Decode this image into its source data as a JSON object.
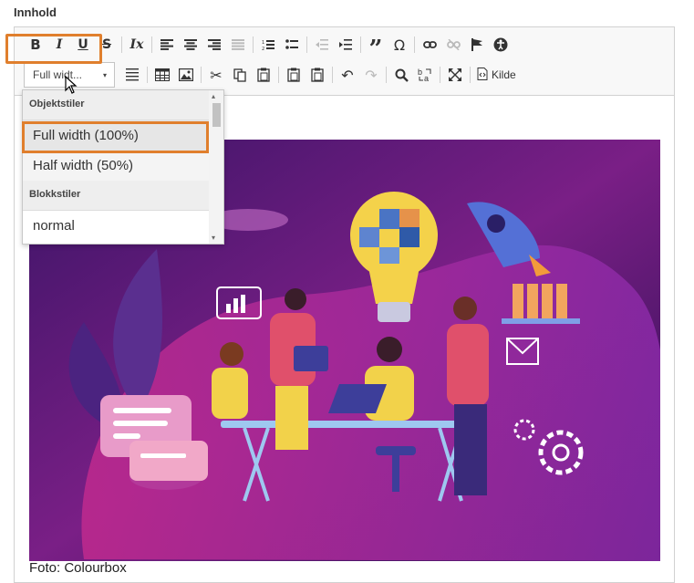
{
  "field": {
    "label": "Innhold"
  },
  "toolbar": {
    "row1": [
      {
        "name": "bold-button",
        "icon": "bold-icon",
        "glyph": "B",
        "style": "bold"
      },
      {
        "name": "italic-button",
        "icon": "italic-icon",
        "glyph": "I",
        "style": "italic"
      },
      {
        "name": "underline-button",
        "icon": "underline-icon",
        "glyph": "U",
        "style": "underline"
      },
      {
        "name": "strikethrough-button",
        "icon": "strikethrough-icon",
        "glyph": "S",
        "style": "strike"
      },
      {
        "sep": true
      },
      {
        "name": "remove-format-button",
        "icon": "remove-format-icon",
        "glyph": "Ix",
        "style": "italic"
      },
      {
        "sep": true
      },
      {
        "name": "align-left-button",
        "icon": "align-left-icon",
        "svg": "alignleft"
      },
      {
        "name": "align-center-button",
        "icon": "align-center-icon",
        "svg": "aligncenter"
      },
      {
        "name": "align-right-button",
        "icon": "align-right-icon",
        "svg": "alignright"
      },
      {
        "name": "justify-button",
        "icon": "justify-icon",
        "svg": "justify",
        "disabled": true
      },
      {
        "sep": true
      },
      {
        "name": "numbered-list-button",
        "icon": "numbered-list-icon",
        "svg": "numlist"
      },
      {
        "name": "bulleted-list-button",
        "icon": "bulleted-list-icon",
        "svg": "bullist"
      },
      {
        "sep": true
      },
      {
        "name": "outdent-button",
        "icon": "outdent-icon",
        "svg": "outdent",
        "disabled": true
      },
      {
        "name": "indent-button",
        "icon": "indent-icon",
        "svg": "indent"
      },
      {
        "sep": true
      },
      {
        "name": "blockquote-button",
        "icon": "quote-icon",
        "glyph": "”",
        "style": "quote"
      },
      {
        "name": "special-char-button",
        "icon": "omega-icon",
        "glyph": "Ω",
        "style": "plain"
      },
      {
        "sep": true
      },
      {
        "name": "link-button",
        "icon": "link-icon",
        "svg": "link"
      },
      {
        "name": "unlink-button",
        "icon": "unlink-icon",
        "svg": "unlink",
        "disabled": true
      },
      {
        "name": "anchor-button",
        "icon": "flag-icon",
        "svg": "flag"
      },
      {
        "name": "accessibility-button",
        "icon": "accessibility-icon",
        "svg": "access"
      }
    ],
    "style_combo": {
      "value": "Full widt...",
      "arrow": "▾"
    },
    "row2": [
      {
        "name": "horizontal-line-button",
        "icon": "horizontal-line-icon",
        "svg": "hr"
      },
      {
        "sep": true
      },
      {
        "name": "table-button",
        "icon": "table-icon",
        "svg": "table"
      },
      {
        "name": "image-button",
        "icon": "image-icon",
        "svg": "image"
      },
      {
        "sep": true
      },
      {
        "name": "cut-button",
        "icon": "scissors-icon",
        "glyph": "✂",
        "style": "plain"
      },
      {
        "name": "copy-button",
        "icon": "copy-icon",
        "svg": "copy"
      },
      {
        "name": "paste-button",
        "icon": "paste-icon",
        "svg": "paste"
      },
      {
        "sep": true
      },
      {
        "name": "paste-text-button",
        "icon": "paste-text-icon",
        "svg": "paste"
      },
      {
        "name": "paste-word-button",
        "icon": "paste-word-icon",
        "svg": "paste"
      },
      {
        "sep": true
      },
      {
        "name": "undo-button",
        "icon": "undo-icon",
        "glyph": "↶",
        "style": "plain"
      },
      {
        "name": "redo-button",
        "icon": "redo-icon",
        "glyph": "↷",
        "style": "plain",
        "disabled": true
      },
      {
        "sep": true
      },
      {
        "name": "find-button",
        "icon": "search-icon",
        "svg": "search"
      },
      {
        "name": "replace-button",
        "icon": "replace-icon",
        "svg": "replace"
      },
      {
        "sep": true
      },
      {
        "name": "maximize-button",
        "icon": "maximize-icon",
        "svg": "maximize"
      },
      {
        "sep": true
      }
    ],
    "source_label": "Kilde"
  },
  "dropdown": {
    "groups": [
      {
        "title": "Objektstiler",
        "items": [
          "Full width (100%)",
          "Half width (50%)"
        ]
      },
      {
        "title": "Blokkstiler",
        "items": [
          "normal"
        ]
      }
    ],
    "selected": "Full width (100%)",
    "scroll_up": "▴",
    "scroll_down": "▾"
  },
  "content": {
    "image_alt": "Team brainstorming illustration with light bulb puzzle",
    "caption": "Foto: Colourbox"
  },
  "colors": {
    "accent_highlight": "#e07f2d",
    "image_bg": "#4b1d72"
  }
}
